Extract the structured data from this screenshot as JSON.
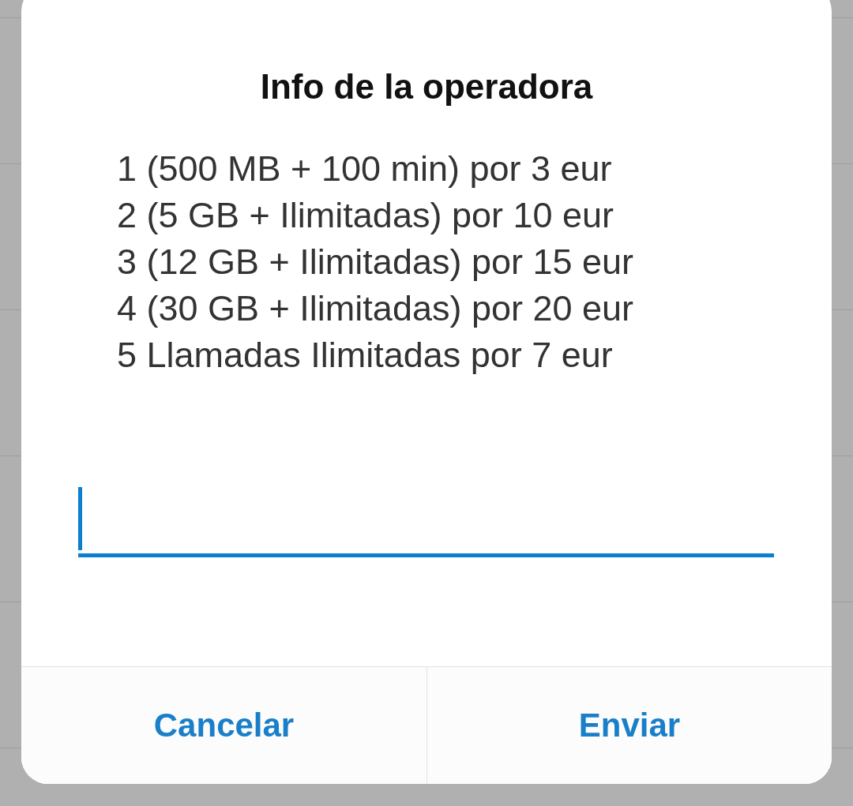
{
  "dialog": {
    "title": "Info de la operadora",
    "lines": [
      "1 (500 MB + 100 min) por 3 eur",
      "2 (5 GB + Ilimitadas) por 10 eur",
      "3 (12 GB + Ilimitadas) por 15 eur",
      "4 (30 GB + Ilimitadas) por 20 eur",
      "5 Llamadas Ilimitadas por 7 eur"
    ],
    "input": {
      "focused": true
    },
    "buttons": [
      "Cancelar",
      "Enviar"
    ]
  }
}
